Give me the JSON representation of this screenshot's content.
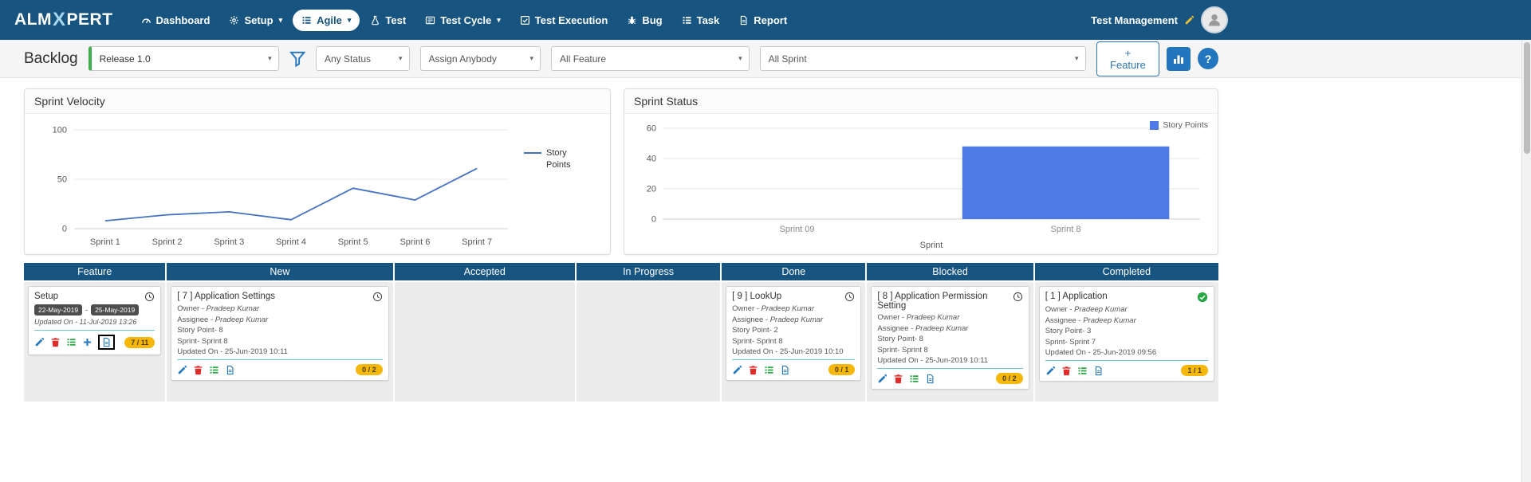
{
  "icons": {
    "caret_down": "▾"
  },
  "navbar": {
    "brand_prefix": "ALM",
    "brand_x": "X",
    "brand_suffix": "PERT",
    "items": [
      {
        "label": "Dashboard"
      },
      {
        "label": "Setup"
      },
      {
        "label": "Agile"
      },
      {
        "label": "Test"
      },
      {
        "label": "Test Cycle"
      },
      {
        "label": "Test Execution"
      },
      {
        "label": "Bug"
      },
      {
        "label": "Task"
      },
      {
        "label": "Report"
      }
    ],
    "user_label": "Test Management"
  },
  "filters": {
    "title": "Backlog",
    "release": "Release 1.0",
    "status": "Any Status",
    "assignee": "Assign Anybody",
    "feature": "All Feature",
    "sprint": "All Sprint",
    "add_feature_label": "+ Feature",
    "help_label": "?"
  },
  "chart_data": [
    {
      "type": "line",
      "title": "Sprint Velocity",
      "categories": [
        "Sprint 1",
        "Sprint 2",
        "Sprint 3",
        "Sprint 4",
        "Sprint 5",
        "Sprint 6",
        "Sprint 7"
      ],
      "series": [
        {
          "name": "Story Points",
          "values": [
            8,
            14,
            17,
            9,
            41,
            29,
            61
          ]
        }
      ],
      "ylim": [
        0,
        100
      ],
      "yticks": [
        0,
        50,
        100
      ],
      "grid": true,
      "legend_position": "right",
      "color": "#4472c4"
    },
    {
      "type": "bar",
      "title": "Sprint Status",
      "categories": [
        "Sprint 09",
        "Sprint 8"
      ],
      "series": [
        {
          "name": "Story Points",
          "values": [
            0,
            48
          ]
        }
      ],
      "xlabel": "Sprint",
      "ylim": [
        0,
        60
      ],
      "yticks": [
        0,
        20,
        40,
        60
      ],
      "grid": true,
      "legend_position": "top-right",
      "color": "#4e7ae7"
    }
  ],
  "kanban": {
    "columns": [
      "Feature",
      "New",
      "Accepted",
      "In Progress",
      "Done",
      "Blocked",
      "Completed"
    ],
    "feature_card": {
      "title": "Setup",
      "start_date": "22-May-2019",
      "date_separator": "-",
      "end_date": "25-May-2019",
      "updated": "Updated On - 11-Jul-2019 13:26",
      "badge": "7 / 11"
    },
    "cards": [
      {
        "title": "[ 7 ] Application Settings",
        "owner_label": "Owner - ",
        "owner": "Pradeep Kumar",
        "assignee_label": "Assignee - ",
        "assignee": "Pradeep Kumar",
        "story_point": "Story Point- 8",
        "sprint": "Sprint- Sprint 8",
        "updated": "Updated On - 25-Jun-2019 10:11",
        "badge": "0 / 2"
      },
      {
        "title": "[ 9 ] LookUp",
        "owner_label": "Owner - ",
        "owner": "Pradeep Kumar",
        "assignee_label": "Assignee - ",
        "assignee": "Pradeep Kumar",
        "story_point": "Story Point- 2",
        "sprint": "Sprint- Sprint 8",
        "updated": "Updated On - 25-Jun-2019 10:10",
        "badge": "0 / 1"
      },
      {
        "title": "[ 8 ] Application Permission Setting",
        "owner_label": "Owner - ",
        "owner": "Pradeep Kumar",
        "assignee_label": "Assignee - ",
        "assignee": "Pradeep Kumar",
        "story_point": "Story Point- 8",
        "sprint": "Sprint- Sprint 8",
        "updated": "Updated On - 25-Jun-2019 10:11",
        "badge": "0 / 2"
      },
      {
        "title": "[ 1 ] Application",
        "owner_label": "Owner - ",
        "owner": "Pradeep Kumar",
        "assignee_label": "Assignee - ",
        "assignee": "Pradeep Kumar",
        "story_point": "Story Point- 3",
        "sprint": "Sprint- Sprint 7",
        "updated": "Updated On - 25-Jun-2019 09:56",
        "badge": "1 / 1"
      }
    ]
  }
}
